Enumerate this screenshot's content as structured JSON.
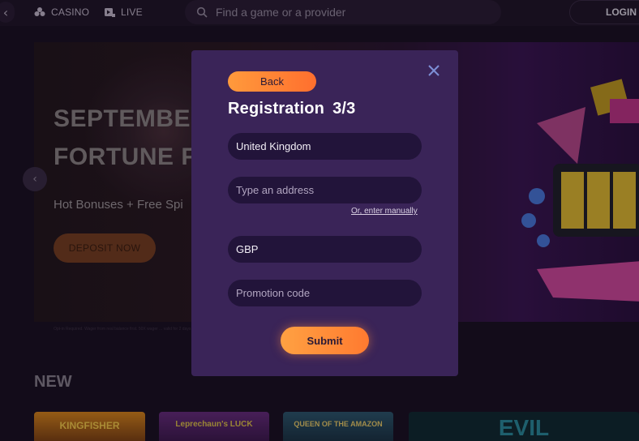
{
  "header": {
    "nav": [
      {
        "label": "CASINO",
        "icon": "casino-icon"
      },
      {
        "label": "LIVE",
        "icon": "live-icon"
      }
    ],
    "search_placeholder": "Find a game or a provider",
    "login_label": "LOGIN"
  },
  "banner": {
    "title_line1": "SEPTEMBE",
    "title_line2": "FORTUNE F",
    "subtitle": "Hot Bonuses + Free Spi",
    "cta_label": "DEPOSIT NOW",
    "fineprint": "Opt-in Required. Wager from real balance first. 50X wager ... valid for 2 days from receipt. Max conversion: 3 times the bonus amount or ... achievement bonuses. Excluded Skill and Window depo..."
  },
  "sections": {
    "new_heading": "NEW"
  },
  "thumbnails": [
    {
      "label": "KINGFISHER"
    },
    {
      "label": "Leprechaun's LUCK"
    },
    {
      "label": "QUEEN OF THE AMAZON"
    },
    {
      "label": "EVIL"
    }
  ],
  "modal": {
    "back_label": "Back",
    "title": "Registration",
    "step": "3/3",
    "country_value": "United Kingdom",
    "address_placeholder": "Type an address",
    "enter_manually_label": "Or, enter manually",
    "currency_value": "GBP",
    "promo_placeholder": "Promotion code",
    "submit_label": "Submit"
  },
  "colors": {
    "modal_bg": "#3a2458",
    "field_bg": "#22143a",
    "accent_orange": "#ff8a36",
    "page_bg": "#1a1021"
  }
}
